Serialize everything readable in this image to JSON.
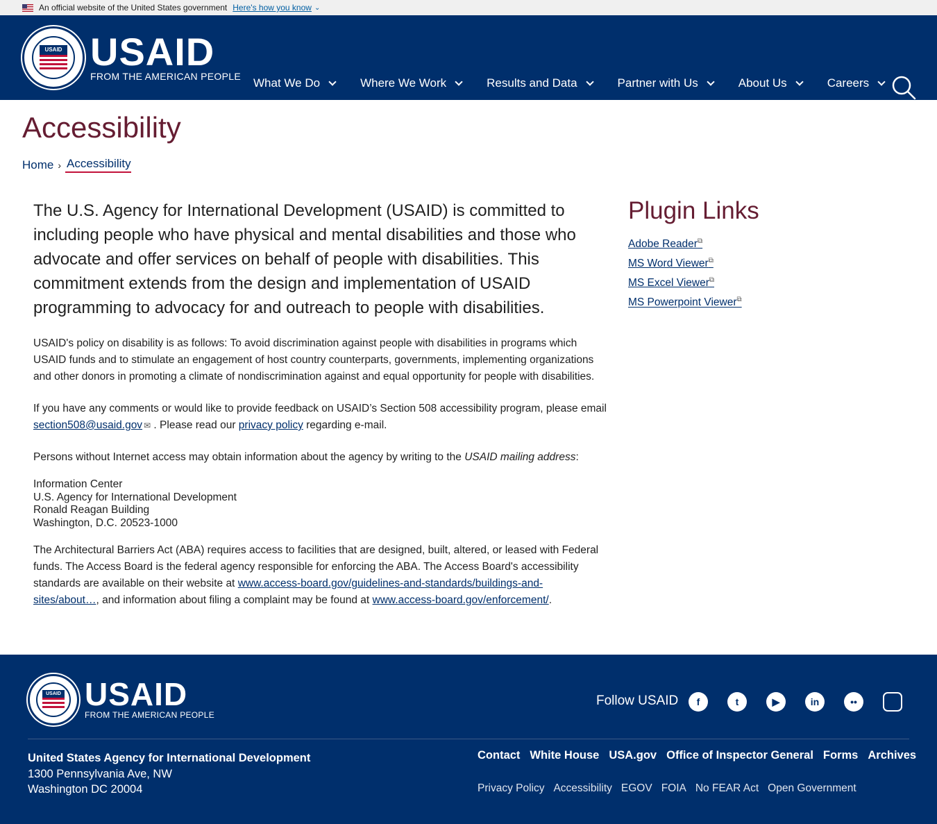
{
  "gov_banner": {
    "text": "An official website of the United States government",
    "link": "Here's how you know"
  },
  "logo": {
    "wordmark": "USAID",
    "tagline": "FROM THE AMERICAN PEOPLE",
    "seal_text": "USAID"
  },
  "nav": {
    "items": [
      {
        "label": "What We Do"
      },
      {
        "label": "Where We Work"
      },
      {
        "label": "Results and Data"
      },
      {
        "label": "Partner with Us"
      },
      {
        "label": "About Us"
      },
      {
        "label": "Careers"
      }
    ]
  },
  "page": {
    "title": "Accessibility",
    "breadcrumb": {
      "home": "Home",
      "current": "Accessibility"
    }
  },
  "content": {
    "lead": "The U.S. Agency for International Development (USAID) is committed to including people who have physical and mental disabilities and those who advocate and offer services on behalf of people with disabilities. This commitment extends from the design and implementation of USAID programming to advocacy for and outreach to people with disabilities.",
    "policy": "USAID's policy on disability is as follows: To avoid discrimination against people with disabilities in programs which USAID funds and to stimulate an engagement of host country counterparts, governments, implementing organizations and other donors in promoting a climate of nondiscrimination against and equal opportunity for people with disabilities.",
    "feedback_pre": "If you have any comments or would like to provide feedback on USAID’s Section 508 accessibility program, please email ",
    "feedback_email": "section508@usaid.gov",
    "feedback_mid": " . Please read our ",
    "feedback_privacy": "privacy policy",
    "feedback_post": " regarding e-mail.",
    "mail_pre": "Persons without Internet access may obtain information about the agency by writing to the ",
    "mail_em": "USAID mailing address",
    "mail_post": ":",
    "address": [
      "Information Center",
      "U.S. Agency for International Development",
      "Ronald Reagan Building",
      "Washington, D.C. 20523-1000"
    ],
    "aba_pre": "The Architectural Barriers Act (ABA) requires access to facilities that are designed, built, altered, or leased with Federal funds. The Access Board is the federal agency responsible for enforcing the ABA. The Access Board's accessibility standards are available on their website at ",
    "aba_link1": "www.access-board.gov/guidelines-and-standards/buildings-and-sites/about…",
    "aba_mid": ", and information about filing a complaint may be found at ",
    "aba_link2": "www.access-board.gov/enforcement/",
    "aba_post": "."
  },
  "sidebar": {
    "title": "Plugin Links",
    "links": [
      {
        "label": "Adobe Reader"
      },
      {
        "label": "MS Word Viewer"
      },
      {
        "label": "MS Excel Viewer"
      },
      {
        "label": "MS Powerpoint Viewer"
      }
    ]
  },
  "footer": {
    "follow": "Follow USAID",
    "social": [
      "facebook-icon",
      "twitter-icon",
      "youtube-icon",
      "linkedin-icon",
      "flickr-icon",
      "instagram-icon"
    ],
    "org_name": "United States Agency for International Development",
    "address_line1": "1300 Pennsylvania Ave, NW",
    "address_line2": "Washington DC 20004",
    "primary_links": [
      "Contact",
      "White House",
      "USA.gov",
      "Office of Inspector General",
      "Forms",
      "Archives"
    ],
    "secondary_links": [
      "Privacy Policy",
      "Accessibility",
      "EGOV",
      "FOIA",
      "No FEAR Act",
      "Open Government"
    ]
  },
  "colors": {
    "navy": "#002F6C",
    "maroon": "#651D32",
    "red": "#C2113A"
  }
}
